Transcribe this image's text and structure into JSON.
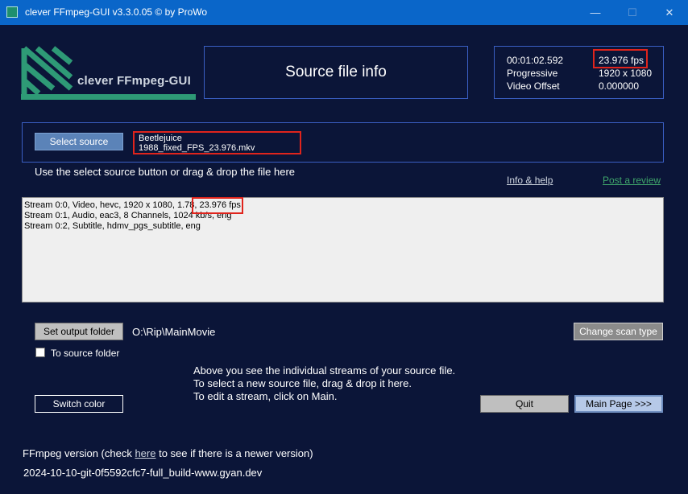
{
  "window": {
    "title": "clever FFmpeg-GUI v3.3.0.05   © by ProWo",
    "minimize": "—",
    "maximize": "☐",
    "close": "✕"
  },
  "logo": {
    "text": "clever FFmpeg-GUI"
  },
  "header": {
    "title": "Source file info"
  },
  "info": {
    "duration": "00:01:02.592",
    "fps": "23.976 fps",
    "scan": "Progressive",
    "resolution": "1920 x 1080",
    "offset_label": "Video Offset",
    "offset_value": "0.000000"
  },
  "source": {
    "select_button": "Select source",
    "filename": "Beetlejuice 1988_fixed_FPS_23.976.mkv",
    "hint": "Use the select source button or drag & drop the file here"
  },
  "links": {
    "info_help": "Info & help",
    "review": "Post a review"
  },
  "streams": [
    "Stream 0:0, Video, hevc, 1920 x 1080, 1.78, 23.976 fps",
    "Stream 0:1, Audio, eac3, 8 Channels, 1024 kb/s, eng",
    "Stream 0:2, Subtitle, hdmv_pgs_subtitle, eng"
  ],
  "output": {
    "set_button": "Set output folder",
    "path": "O:\\Rip\\MainMovie",
    "to_source_label": "To source folder",
    "change_scan_button": "Change scan type"
  },
  "instructions": [
    "Above you see the individual streams of your source file.",
    "To select a new source file, drag & drop it here.",
    "To edit a stream, click on Main."
  ],
  "buttons": {
    "switch_color": "Switch color",
    "quit": "Quit",
    "main_page": "Main Page >>>"
  },
  "ffmpeg": {
    "version_prefix": "FFmpeg version (check ",
    "version_link": "here",
    "version_suffix": " to see if there is a newer version)",
    "build": "2024-10-10-git-0f5592cfc7-full_build-www.gyan.dev"
  }
}
